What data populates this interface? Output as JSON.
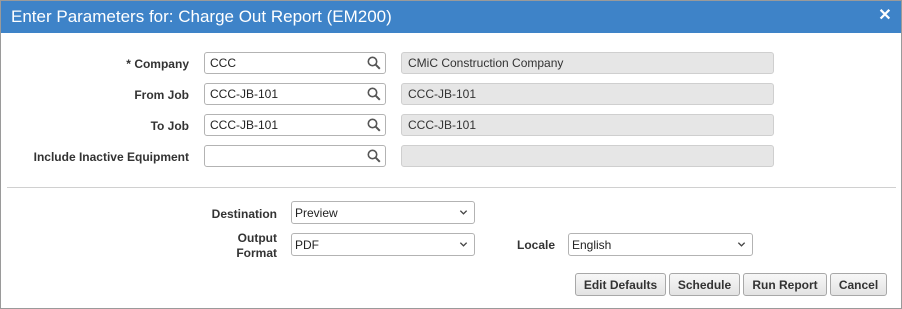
{
  "dialog": {
    "title": "Enter Parameters for: Charge Out Report (EM200)",
    "close_icon": "close-icon"
  },
  "params": {
    "company": {
      "required_marker": "*",
      "label": "Company",
      "value": "CCC",
      "description": "CMiC Construction Company"
    },
    "from_job": {
      "label": "From Job",
      "value": "CCC-JB-101",
      "description": "CCC-JB-101"
    },
    "to_job": {
      "label": "To Job",
      "value": "CCC-JB-101",
      "description": "CCC-JB-101"
    },
    "include_inactive": {
      "label": "Include Inactive Equipment",
      "value": "",
      "description": ""
    }
  },
  "output": {
    "destination": {
      "label": "Destination",
      "value": "Preview"
    },
    "format": {
      "label_line1": "Output",
      "label_line2": "Format",
      "value": "PDF"
    },
    "locale": {
      "label": "Locale",
      "value": "English"
    }
  },
  "buttons": {
    "edit_defaults": "Edit Defaults",
    "schedule": "Schedule",
    "run_report": "Run Report",
    "cancel": "Cancel"
  },
  "colors": {
    "titlebar": "#3e83c8",
    "readonly_bg": "#e6e6e6"
  }
}
